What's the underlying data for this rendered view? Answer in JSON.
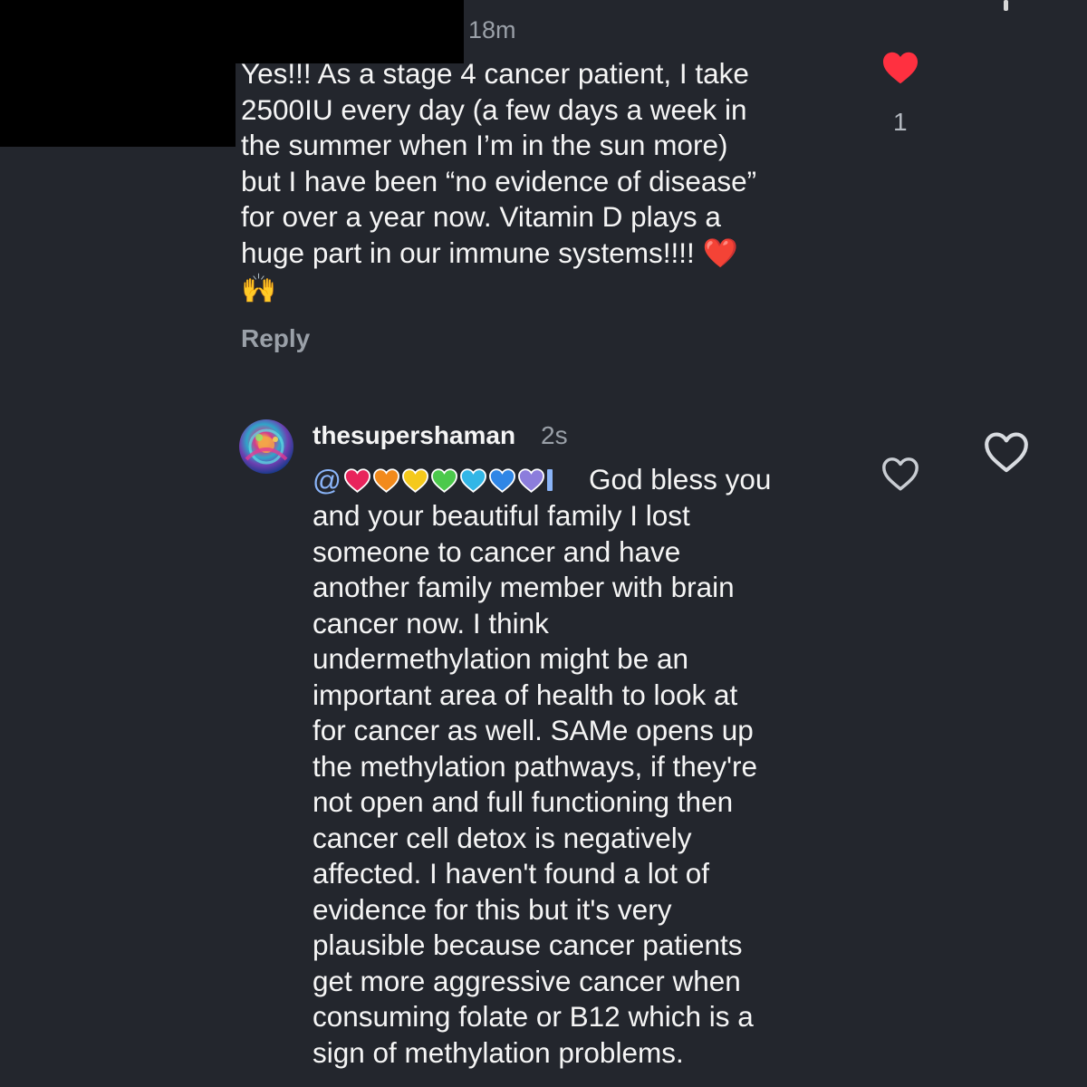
{
  "first_comment": {
    "time": "18m",
    "text": "Yes!!! As a stage 4 cancer patient, I take\n2500IU every day (a few days a week in\nthe summer when I’m in the sun more)\nbut I have been “no evidence of disease”\nfor over a year now. Vitamin D plays a\nhuge part in our immune systems!!!! ❤️\n🙌",
    "reply_label": "Reply",
    "like_count": "1",
    "liked": true
  },
  "second_comment": {
    "username": "thesupershaman",
    "time": "2s",
    "mention_prefix": "@",
    "first_line": "God bless you",
    "text": "and your beautiful family I lost\nsomeone to cancer and have\nanother family member with brain\ncancer now. I think\nundermethylation might be an\nimportant area of health to look at\nfor cancer as well. SAMe opens up\nthe methylation pathways, if they're\nnot open and full functioning then\ncancer cell detox is negatively\naffected. I haven't found a lot of\nevidence for this but it's very\nplausible because cancer patients\nget more aggressive cancer when\nconsuming folate or B12 which is a\nsign of methylation problems.",
    "liked": false
  },
  "colors": {
    "background": "#23262d",
    "like_red": "#ff3040",
    "text_primary": "#f5f5f5",
    "text_secondary": "#9aa0a8",
    "mention": "#8ab4f8",
    "mention_hearts": [
      "#e8245c",
      "#f28a1c",
      "#f5c91c",
      "#4cc94c",
      "#32b6e6",
      "#2f86e6",
      "#8c7ddc"
    ]
  },
  "icons": {
    "like_filled": "heart-filled-icon",
    "like_outline": "heart-outline-icon",
    "avatar": "user-avatar"
  }
}
